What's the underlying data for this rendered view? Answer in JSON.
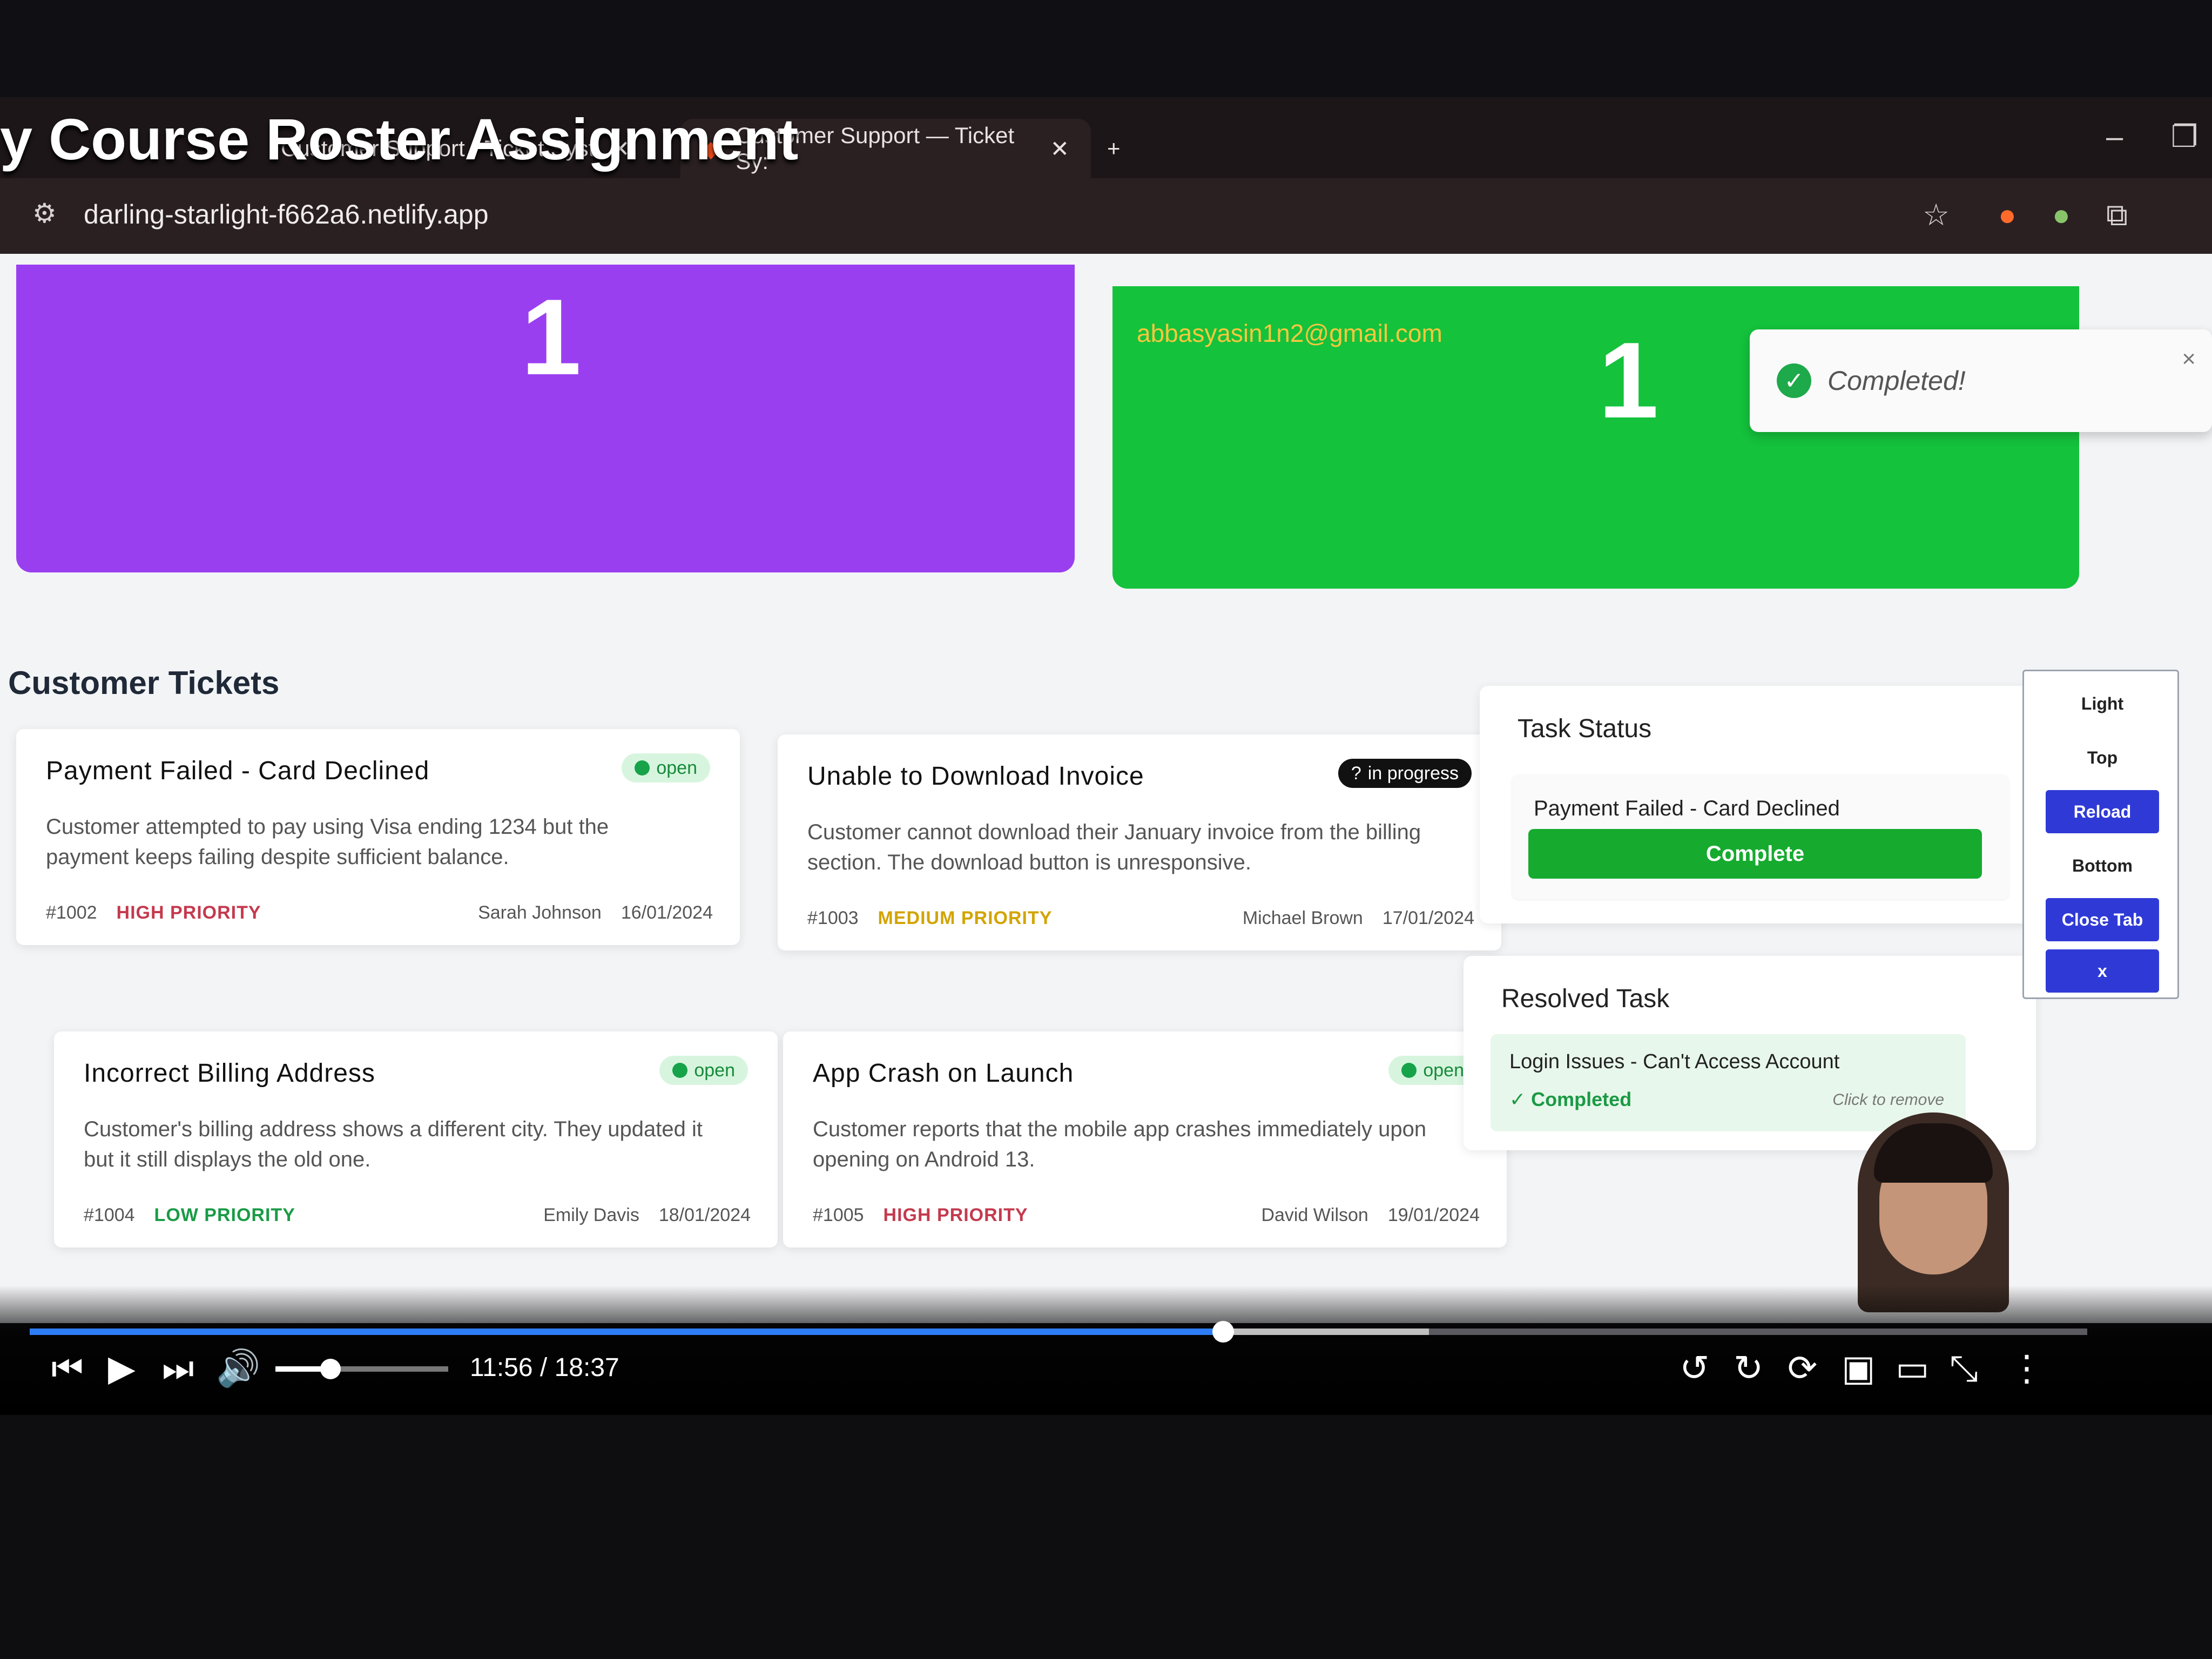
{
  "overlay": {
    "video_title": "y Course Roster Assignment"
  },
  "browser": {
    "tabs": [
      {
        "label": "Customer Support - Ticket Syst",
        "active": false
      },
      {
        "label": "Customer Support — Ticket Sy:",
        "active": true
      }
    ],
    "url": "darling-starlight-f662a6.netlify.app",
    "icons": [
      "tune-icon",
      "star-icon",
      "extension-icon",
      "minimize-icon",
      "restore-icon",
      "new-tab-icon",
      "close-icon"
    ]
  },
  "stats": {
    "in_progress": {
      "count": "1",
      "color": "#9a3ff0"
    },
    "resolved": {
      "count": "1",
      "color": "#14c23c"
    },
    "email": "abbasyasin1n2@gmail.com"
  },
  "toast": {
    "message": "Completed!",
    "close": "×"
  },
  "tickets_section": {
    "title": "Customer Tickets",
    "tickets": [
      {
        "title": "Payment Failed - Card Declined",
        "status": "open",
        "description": "Customer attempted to pay using Visa ending 1234 but the payment keeps failing despite sufficient balance.",
        "id": "#1002",
        "priority": "HIGH PRIORITY",
        "customer": "Sarah Johnson",
        "date": "16/01/2024"
      },
      {
        "title": "Unable to Download Invoice",
        "status": "in progress",
        "description": "Customer cannot download their January invoice from the billing section. The download button is unresponsive.",
        "id": "#1003",
        "priority": "MEDIUM PRIORITY",
        "customer": "Michael Brown",
        "date": "17/01/2024"
      },
      {
        "title": "Incorrect Billing Address",
        "status": "open",
        "description": "Customer's billing address shows a different city. They updated it but it still displays the old one.",
        "id": "#1004",
        "priority": "LOW PRIORITY",
        "customer": "Emily Davis",
        "date": "18/01/2024"
      },
      {
        "title": "App Crash on Launch",
        "status": "open",
        "description": "Customer reports that the mobile app crashes immediately upon opening on Android 13.",
        "id": "#1005",
        "priority": "HIGH PRIORITY",
        "customer": "David Wilson",
        "date": "19/01/2024"
      }
    ],
    "status_prefix_in_progress": "?"
  },
  "task_status": {
    "title": "Task Status",
    "item_title": "Payment Failed - Card Declined",
    "button_label": "Complete"
  },
  "resolved_task": {
    "title": "Resolved Task",
    "item_title": "Login Issues - Can't Access Account",
    "status": "✓ Completed",
    "remove_hint": "Click to remove"
  },
  "dev_toolbar": {
    "buttons": [
      "Light",
      "Top",
      "Reload",
      "Bottom",
      "Close Tab",
      "x"
    ]
  },
  "video_player": {
    "time": "11:56 / 18:37",
    "progress": 0.58,
    "buffered": 0.68,
    "volume": 0.32
  }
}
